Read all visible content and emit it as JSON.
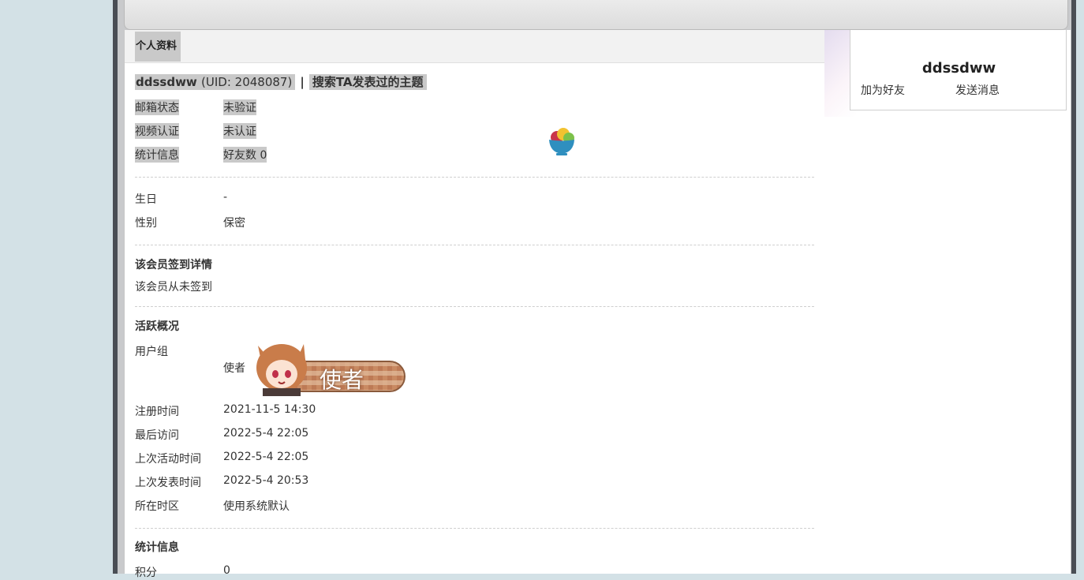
{
  "tab": {
    "label": "个人资料"
  },
  "profile": {
    "username": "ddssdww",
    "uid_text": "(UID: 2048087)",
    "separator": "|",
    "search_link": "搜索TA发表过的主题"
  },
  "basic": [
    {
      "label": "邮箱状态",
      "value": "未验证"
    },
    {
      "label": "视频认证",
      "value": "未认证"
    },
    {
      "label": "统计信息",
      "value": "好友数 0"
    }
  ],
  "personal": [
    {
      "label": "生日",
      "value": "-"
    },
    {
      "label": "性别",
      "value": "保密"
    }
  ],
  "checkin": {
    "title": "该会员签到详情",
    "text": "该会员从未签到"
  },
  "activity": {
    "title": "活跃概况",
    "group_label": "用户组",
    "group_value": "使者",
    "badge_text": "使者",
    "rows": [
      {
        "label": "注册时间",
        "value": "2021-11-5 14:30"
      },
      {
        "label": "最后访问",
        "value": "2022-5-4 22:05"
      },
      {
        "label": "上次活动时间",
        "value": "2022-5-4 22:05"
      },
      {
        "label": "上次发表时间",
        "value": "2022-5-4 20:53"
      },
      {
        "label": "所在时区",
        "value": "使用系统默认"
      }
    ]
  },
  "stats": {
    "title": "统计信息",
    "rows": [
      {
        "label": "积分",
        "value": "0"
      }
    ]
  },
  "sidebar": {
    "name": "ddssdww",
    "add_friend": "加为好友",
    "send_message": "发送消息"
  },
  "icons": {
    "fruit_bowl": "fruit-bowl-icon",
    "avatar_badge": "anime-girl-badge"
  },
  "colors": {
    "highlight": "#c9c9c9",
    "page_bg": "#d3e1e6",
    "frame": "#4a4e55"
  }
}
